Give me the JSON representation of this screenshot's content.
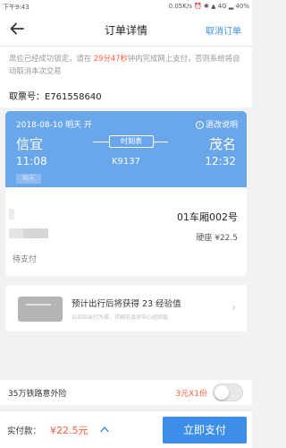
{
  "status_bar": {
    "time": "下午9:43",
    "right": "0.05K/s ⏰ ✱ ▲ 4G ▂ 40%"
  },
  "header": {
    "title": "订单详情",
    "cancel_label": "取消订单"
  },
  "notice": {
    "prefix": "席位已经成功锁定，请在 ",
    "countdown": "29分47秒",
    "suffix": "钟内完成网上支付，否则系统将自动取消本次交易"
  },
  "ticket_no": {
    "label": "取票号：",
    "value": "E761558640"
  },
  "trip": {
    "date": "2018-08-10 明天 开",
    "refund_label": "退改说明",
    "info_glyph": "i",
    "from_station": "信宜",
    "to_station": "茂名",
    "schedule_label": "时刻表",
    "departure_time": "11:08",
    "arrival_time": "12:32",
    "train_no": "K9137",
    "tag": "明天"
  },
  "passenger": {
    "carriage": "01车厢002号",
    "seat": "硬座  ¥22.5",
    "status": "待支付"
  },
  "experience": {
    "text": "预计出行后将获得 23 经验值",
    "subtext": "以实际出行为准，详细见会员中心经验值",
    "chevron": "›"
  },
  "insurance": {
    "label": "35万铁路意外险",
    "price": "3元X1份",
    "enabled": false
  },
  "payment": {
    "label": "实付款：",
    "amount": "¥22.5元",
    "pay_button": "立即支付"
  },
  "colors": {
    "accent": "#3d8ee8",
    "card_blue": "#6aa6ea",
    "highlight": "#ff5a3c"
  }
}
